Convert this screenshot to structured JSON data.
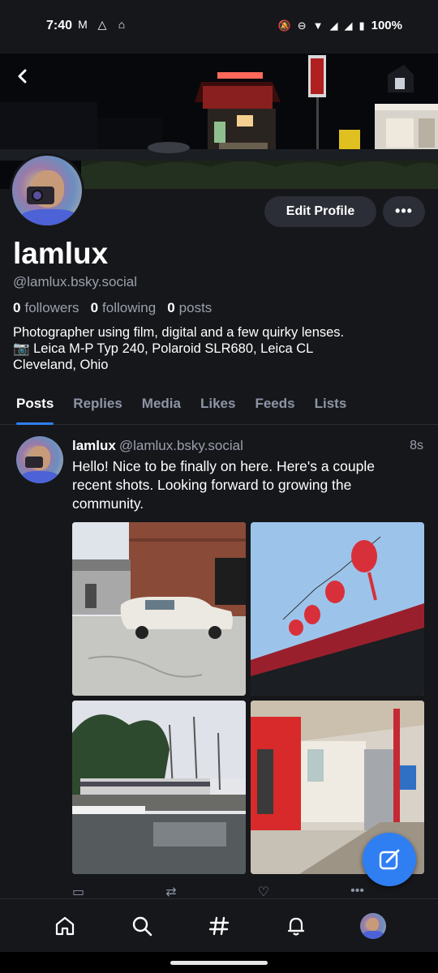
{
  "status_bar": {
    "time": "7:40",
    "left_icons": [
      "gmail-icon",
      "drive-icon",
      "bank-icon"
    ],
    "right_icons": [
      "mute-icon",
      "dnd-icon",
      "wifi-icon",
      "signal-icon",
      "signal-icon",
      "battery-icon"
    ],
    "battery": "100%"
  },
  "profile": {
    "display_name": "lamlux",
    "handle": "@lamlux.bsky.social",
    "followers_count": "0",
    "followers_label": "followers",
    "following_count": "0",
    "following_label": "following",
    "posts_count": "0",
    "posts_label": "posts",
    "bio_lines": [
      "Photographer using film, digital and a few quirky lenses.",
      "📷 Leica M-P Typ 240, Polaroid SLR680, Leica CL",
      "Cleveland, Ohio"
    ],
    "edit_label": "Edit Profile",
    "more_label": "•••"
  },
  "tabs": [
    {
      "label": "Posts",
      "active": true
    },
    {
      "label": "Replies",
      "active": false
    },
    {
      "label": "Media",
      "active": false
    },
    {
      "label": "Likes",
      "active": false
    },
    {
      "label": "Feeds",
      "active": false
    },
    {
      "label": "Lists",
      "active": false
    }
  ],
  "post": {
    "author": "lamlux",
    "handle": "@lamlux.bsky.social",
    "time": "8s",
    "text": "Hello! Nice to be finally on here. Here's a couple recent shots. Looking forward to growing the community.",
    "images": [
      "photo-white-car",
      "photo-red-lanterns",
      "photo-train-trees",
      "photo-storefront"
    ]
  },
  "bottom_nav": [
    "home-icon",
    "search-icon",
    "feeds-hash-icon",
    "notifications-bell-icon",
    "profile-avatar"
  ],
  "colors": {
    "background": "#16171b",
    "accent": "#2f7ff3",
    "muted_text": "#9aa0ab",
    "button_bg": "#2b2e36"
  }
}
